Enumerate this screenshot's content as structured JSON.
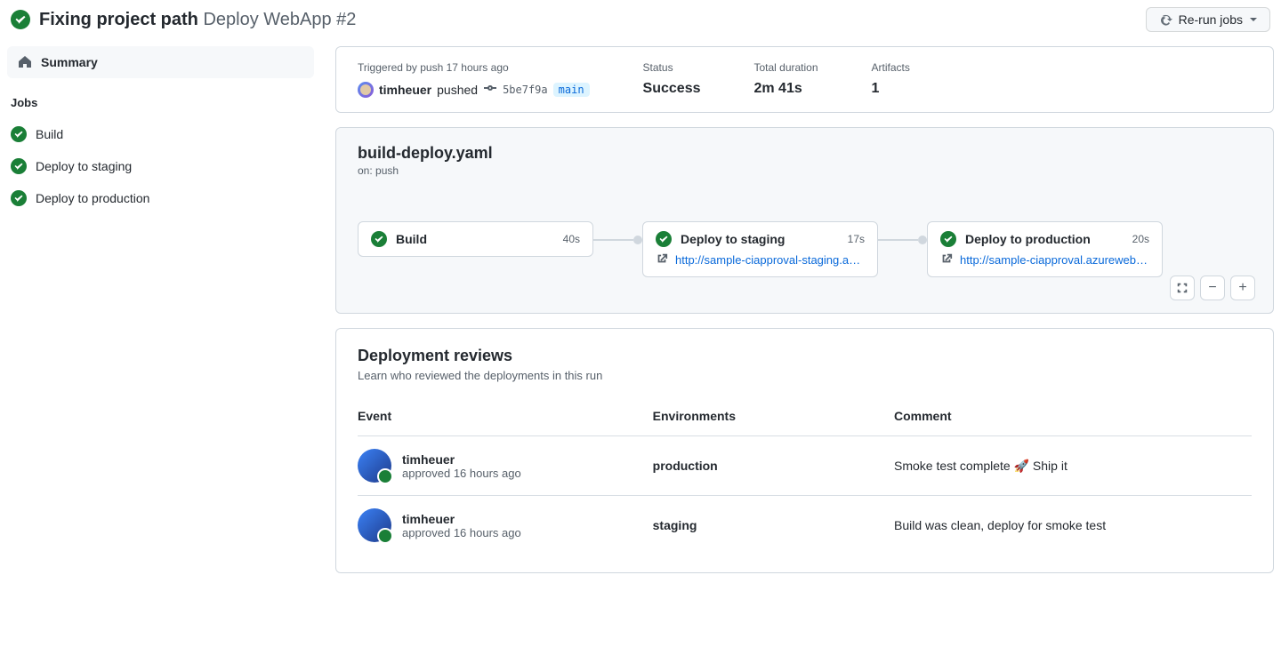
{
  "header": {
    "status": "success",
    "title": "Fixing project path",
    "subtitle": "Deploy WebApp #2",
    "rerun_label": "Re-run jobs"
  },
  "sidebar": {
    "summary_label": "Summary",
    "jobs_heading": "Jobs",
    "jobs": [
      {
        "name": "Build"
      },
      {
        "name": "Deploy to staging"
      },
      {
        "name": "Deploy to production"
      }
    ]
  },
  "summary": {
    "triggered_label": "Triggered by push 17 hours ago",
    "username": "timheuer",
    "action": "pushed",
    "sha": "5be7f9a",
    "branch": "main",
    "status_label": "Status",
    "status_value": "Success",
    "duration_label": "Total duration",
    "duration_value": "2m 41s",
    "artifacts_label": "Artifacts",
    "artifacts_value": "1"
  },
  "workflow": {
    "filename": "build-deploy.yaml",
    "trigger": "on: push",
    "jobs": [
      {
        "name": "Build",
        "duration": "40s",
        "url": ""
      },
      {
        "name": "Deploy to staging",
        "duration": "17s",
        "url": "http://sample-ciapproval-staging.azur…"
      },
      {
        "name": "Deploy to production",
        "duration": "20s",
        "url": "http://sample-ciapproval.azurewebsit…"
      }
    ]
  },
  "reviews": {
    "title": "Deployment reviews",
    "subtitle": "Learn who reviewed the deployments in this run",
    "headers": {
      "event": "Event",
      "env": "Environments",
      "comment": "Comment"
    },
    "rows": [
      {
        "user": "timheuer",
        "action": "approved 16 hours ago",
        "env": "production",
        "comment": "Smoke test complete 🚀 Ship it"
      },
      {
        "user": "timheuer",
        "action": "approved 16 hours ago",
        "env": "staging",
        "comment": "Build was clean, deploy for smoke test"
      }
    ]
  }
}
